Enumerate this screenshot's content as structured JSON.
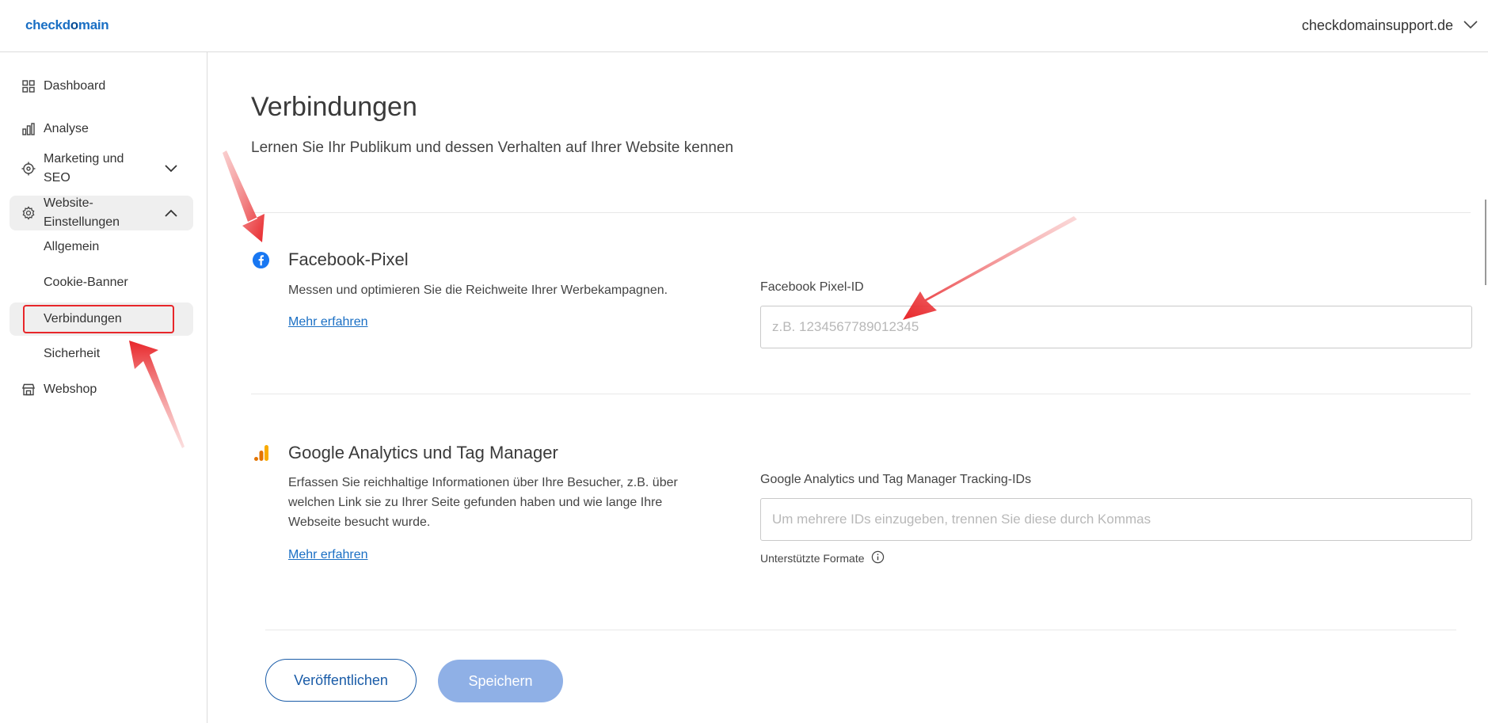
{
  "header": {
    "logo_part1": "checkd",
    "logo_part2": "o",
    "logo_part3": "main",
    "domain": "checkdomainsupport.de"
  },
  "sidebar": {
    "items": [
      {
        "label": "Dashboard",
        "icon": "grid-icon"
      },
      {
        "label": "Analyse",
        "icon": "bar-chart-icon"
      },
      {
        "label": "Marketing und SEO",
        "icon": "target-icon"
      },
      {
        "label": "Website-Einstellungen",
        "icon": "gear-icon"
      },
      {
        "label": "Webshop",
        "icon": "shop-icon"
      }
    ],
    "subitems": [
      {
        "label": "Allgemein"
      },
      {
        "label": "Cookie-Banner"
      },
      {
        "label": "Verbindungen"
      },
      {
        "label": "Sicherheit"
      }
    ]
  },
  "main": {
    "title": "Verbindungen",
    "subtitle": "Lernen Sie Ihr Publikum und dessen Verhalten auf Ihrer Website kennen",
    "facebook": {
      "title": "Facebook-Pixel",
      "description": "Messen und optimieren Sie die Reichweite Ihrer Werbekampagnen.",
      "link": "Mehr erfahren",
      "field_label": "Facebook Pixel-ID",
      "placeholder": "z.B. 1234567789012345"
    },
    "google": {
      "title": "Google Analytics und Tag Manager",
      "description": "Erfassen Sie reichhaltige Informationen über Ihre Besucher, z.B. über welchen Link sie zu Ihrer Seite gefunden haben und wie lange Ihre Webseite besucht wurde.",
      "link": "Mehr erfahren",
      "field_label": "Google Analytics und Tag Manager Tracking-IDs",
      "placeholder": "Um mehrere IDs einzugeben, trennen Sie diese durch Kommas",
      "help": "Unterstützte Formate"
    },
    "actions": {
      "publish": "Veröffentlichen",
      "save": "Speichern"
    }
  },
  "colors": {
    "accent": "#1a6fc4",
    "save_disabled": "#8fb0e6",
    "annotation": "#e8262a",
    "facebook": "#1877f2",
    "analytics_dark": "#e37400",
    "analytics_light": "#f9ab00"
  }
}
